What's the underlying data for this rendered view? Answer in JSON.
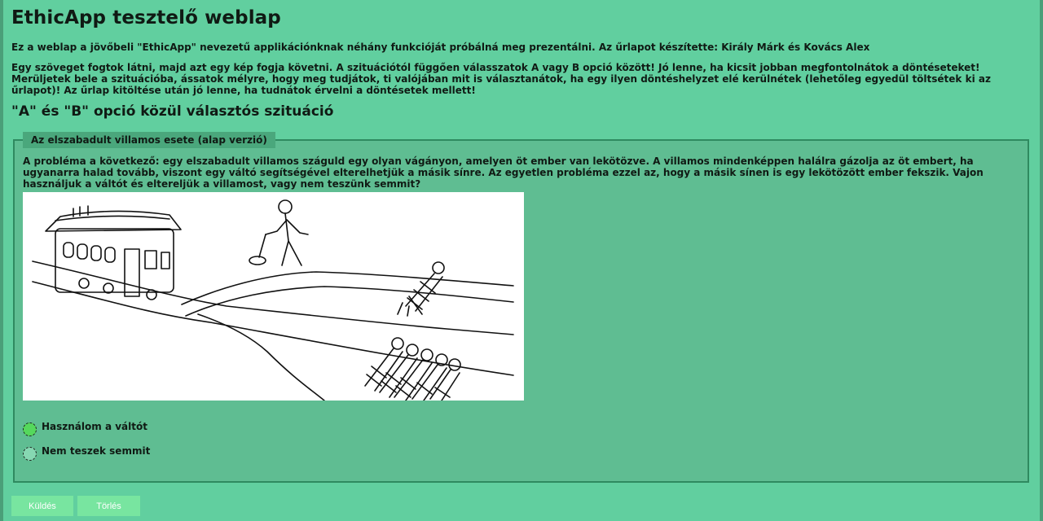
{
  "page": {
    "title": "EthicApp tesztelő weblap",
    "intro": "Ez a weblap a jövőbeli \"EthicApp\" nevezetű applikációnknak néhány funkcióját próbálná meg prezentálni. Az űrlapot készítette: Király Márk és Kovács Alex",
    "description": "Egy szöveget fogtok látni, majd azt egy kép fogja követni. A szituációtól függően válasszatok A vagy B opció között! Jó lenne, ha kicsit jobban megfontolnátok a döntéseteket! Merüljetek bele a szituációba, ássatok mélyre, hogy meg tudjátok, ti valójában mit is választanátok, ha egy ilyen döntéshelyzet elé kerülnétek (lehetőleg egyedül töltsétek ki az űrlapot)! Az űrlap kitöltése után jó lenne, ha tudnátok érvelni a döntésetek mellett!",
    "section_heading": "\"A\" és \"B\" opció közül választós szituáció"
  },
  "scenario": {
    "legend": "Az elszabadult villamos esete (alap verzió)",
    "problem": "A probléma a következő: egy elszabadult villamos száguld egy olyan vágányon, amelyen öt ember van lekötözve. A villamos mindenképpen halálra gázolja az öt embert, ha ugyanarra halad tovább, viszont egy váltó segítségével elterelhetjük a másik sínre. Az egyetlen probléma ezzel az, hogy a másik sínen is egy lekötözött ember fekszik. Vajon használjuk a váltót és eltereljük a villamost, vagy nem teszünk semmit?",
    "options": [
      {
        "label": "Használom a váltót",
        "selected": true
      },
      {
        "label": "Nem teszek semmit",
        "selected": false
      }
    ]
  },
  "buttons": {
    "submit": "Küldés",
    "reset": "Törlés"
  },
  "colors": {
    "background": "#61cf9f",
    "fieldset_bg": "#5fbd92",
    "button_bg": "#78e5a0",
    "radio_selected": "#55d85c"
  }
}
